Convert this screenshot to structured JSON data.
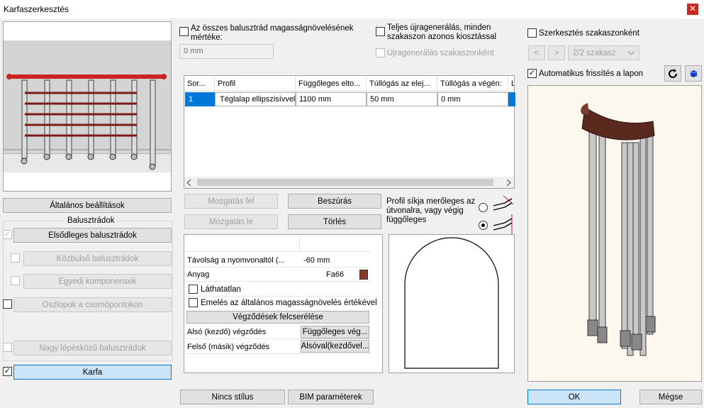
{
  "window": {
    "title": "Karfaszerkesztés",
    "close_glyph": "✕"
  },
  "left": {
    "general_settings": "Általános beállítások",
    "balusters_group": "Balusztrádok",
    "primary": "Elsődleges balusztrádok",
    "intermediate": "Közbülső balusztrádok",
    "custom": "Egyedi komponensek",
    "posts": "Oszlopok a csomópontokon",
    "large_step": "Nagy lépésközű balusztrádok",
    "handrail": "Karfa",
    "check_glyph": "✓"
  },
  "top": {
    "all_height_label": "Az összes balusztrád magasságnövelésének mértéke:",
    "all_height_value": "0 mm",
    "full_regen_label": "Teljes újragenerálás, minden szakaszon azonos kiosztással",
    "regen_by_section": "Újragenerálás szakaszonként",
    "edit_by_section": "Szerkesztés szakaszonként",
    "prev": "<",
    "next": ">",
    "section_select": "2/2 szakasz",
    "auto_refresh": "Automatikus frissítés a lapon"
  },
  "grid": {
    "headers": [
      "Sor...",
      "Profil",
      "Függőleges elto...",
      "Túllógás az elej...",
      "Túllógás a végén:",
      "L"
    ],
    "row": {
      "index": "1",
      "profile": "Téglalap ellipszisívvel",
      "vertical": "1100 mm",
      "overhang_start": "50 mm",
      "overhang_end": "0 mm"
    }
  },
  "actions": {
    "move_up": "Mozgatás fel",
    "insert": "Beszúrás",
    "move_down": "Mozgatás le",
    "delete": "Törlés",
    "profile_plane_label": "Profil síkja merőleges az útvonalra, vagy végig függőleges"
  },
  "props": {
    "distance_label": "Távolság a nyomvonaltól (...",
    "distance_value": "-60 mm",
    "material_label": "Anyag",
    "material_value": "Fa66",
    "material_color": "#8b3a2e",
    "invisible": "Láthatatlan",
    "raise_label": "Emelés az általános magasságnövelés értékével",
    "swap_ends": "Végződések felcserélése",
    "lower_end_label": "Alsó (kezdő) végződés",
    "lower_end_value": "Függőleges vég...",
    "upper_end_label": "Felső (másik) végződés",
    "upper_end_value": "Alsóval(kezdővel..."
  },
  "bottom": {
    "no_style": "Nincs stílus",
    "bim": "BIM paraméterek",
    "ok": "OK",
    "cancel": "Mégse"
  },
  "colors": {
    "accent": "#0078d7",
    "rail_red": "#cc2222",
    "wood": "#5a2a1e"
  },
  "icons": [
    "refresh-icon",
    "cube-icon",
    "close-icon",
    "chevron-left-icon",
    "chevron-right-icon",
    "chevron-down-icon"
  ]
}
